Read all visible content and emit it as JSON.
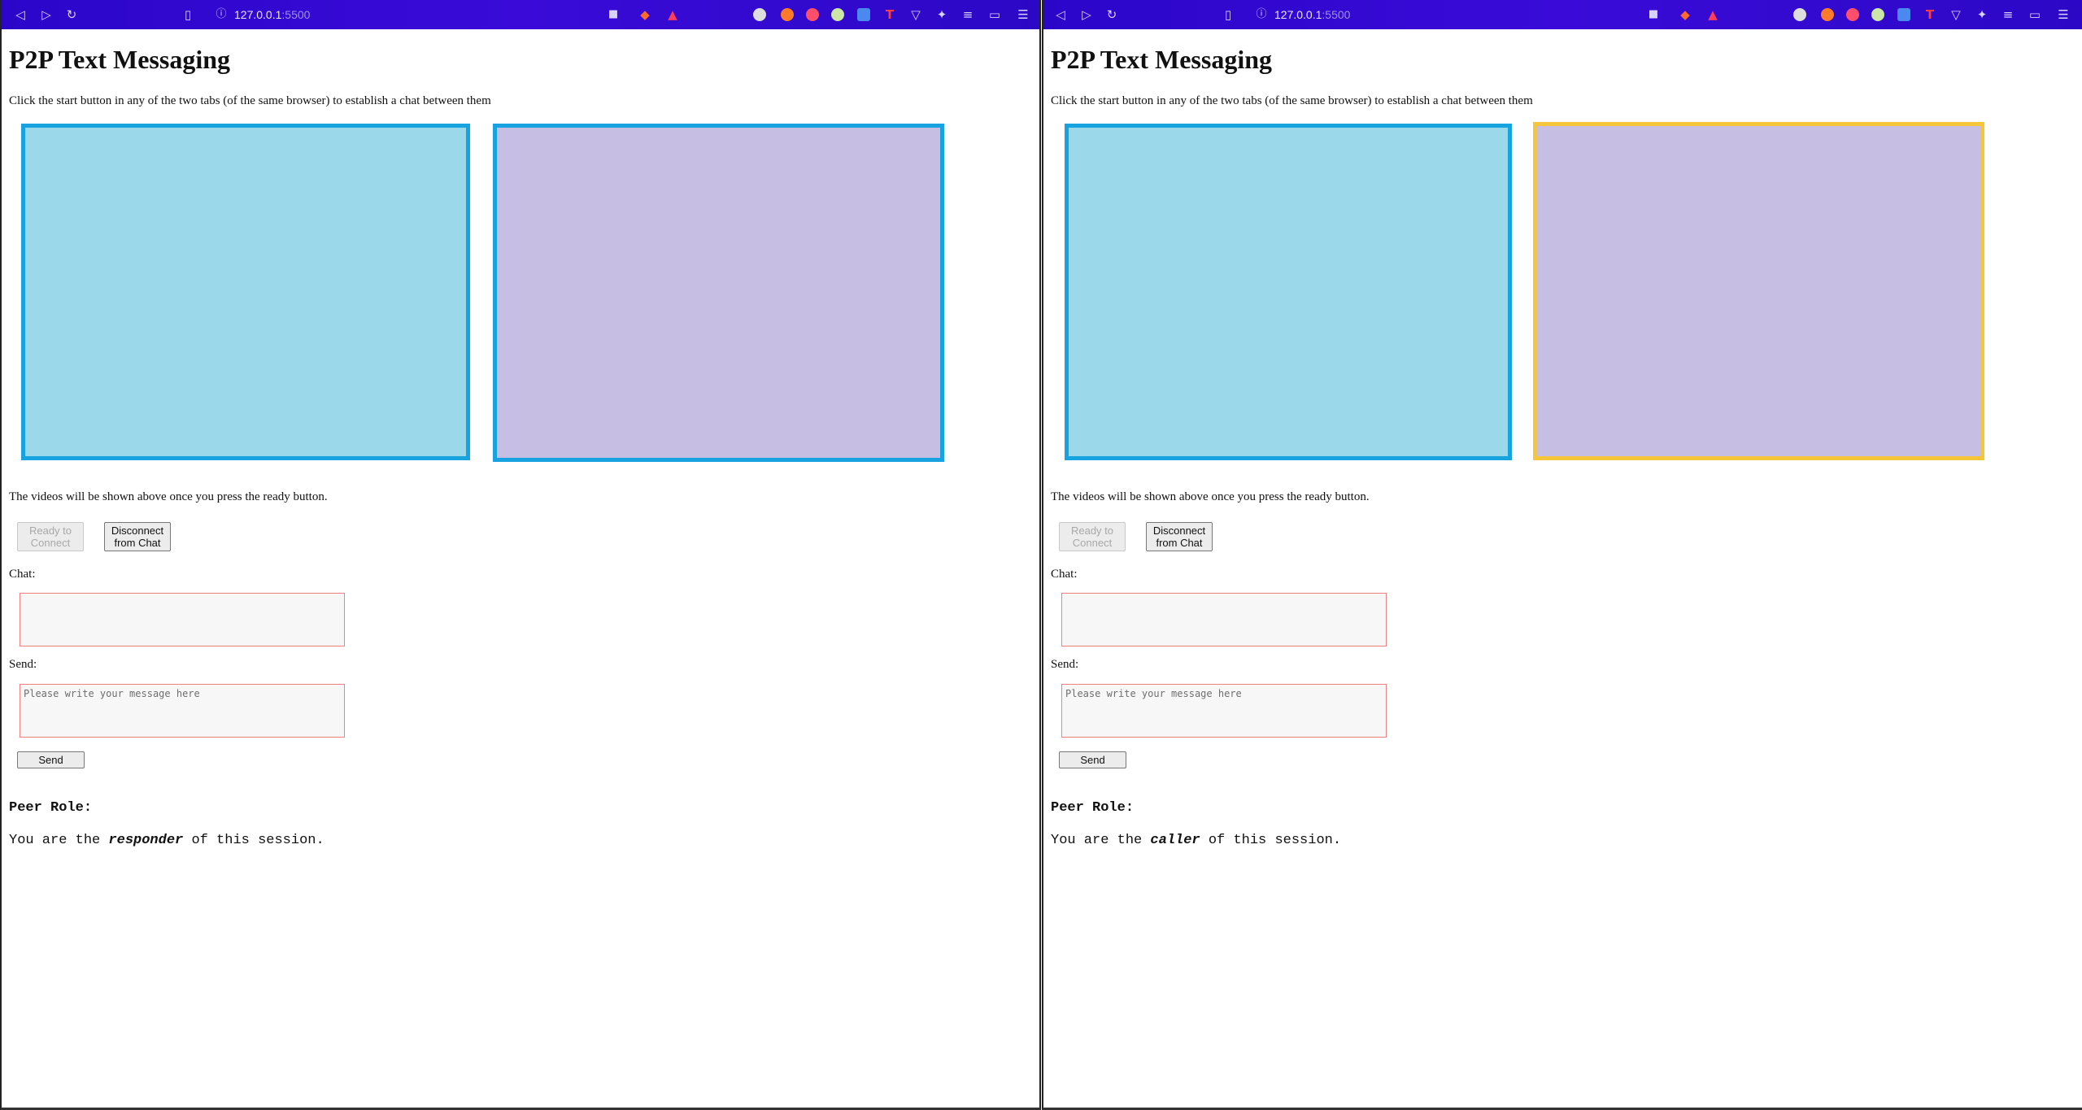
{
  "browser": {
    "url_host": "127.0.0.1",
    "url_port": ":5500"
  },
  "colors": {
    "video_border": "#16a3e0",
    "caller_remote_border": "#f5c63c",
    "local_video_bg": "#9ad8ea",
    "remote_video_bg": "#c6bee3",
    "toolbar": "#2b06c9"
  },
  "icons": [
    "back-icon",
    "forward-icon",
    "reload-icon",
    "bookmark-icon",
    "site-info-icon",
    "camera-icon",
    "brave-shield-icon",
    "brave-rewards-icon",
    "extensions-icon",
    "reading-list-icon",
    "wallet-icon",
    "menu-icon"
  ],
  "windows": [
    {
      "page": {
        "title": "P2P Text Messaging",
        "intro": "Click the start button in any of the two tabs (of the same browser) to establish a chat between them",
        "videos_note": "The videos will be shown above once you press the ready button.",
        "ready_label_1": "Ready to",
        "ready_label_2": "Connect",
        "disconnect_label_1": "Disconnect",
        "disconnect_label_2": "from Chat",
        "chat_label": "Chat:",
        "send_label": "Send:",
        "send_placeholder": "Please write your message here",
        "send_button": "Send",
        "role_heading": "Peer Role:",
        "role_prefix": "You are the ",
        "role": "responder",
        "role_suffix": " of this session."
      }
    },
    {
      "page": {
        "title": "P2P Text Messaging",
        "intro": "Click the start button in any of the two tabs (of the same browser) to establish a chat between them",
        "videos_note": "The videos will be shown above once you press the ready button.",
        "ready_label_1": "Ready to",
        "ready_label_2": "Connect",
        "disconnect_label_1": "Disconnect",
        "disconnect_label_2": "from Chat",
        "chat_label": "Chat:",
        "send_label": "Send:",
        "send_placeholder": "Please write your message here",
        "send_button": "Send",
        "role_heading": "Peer Role:",
        "role_prefix": "You are the ",
        "role": "caller",
        "role_suffix": " of this session."
      }
    }
  ]
}
